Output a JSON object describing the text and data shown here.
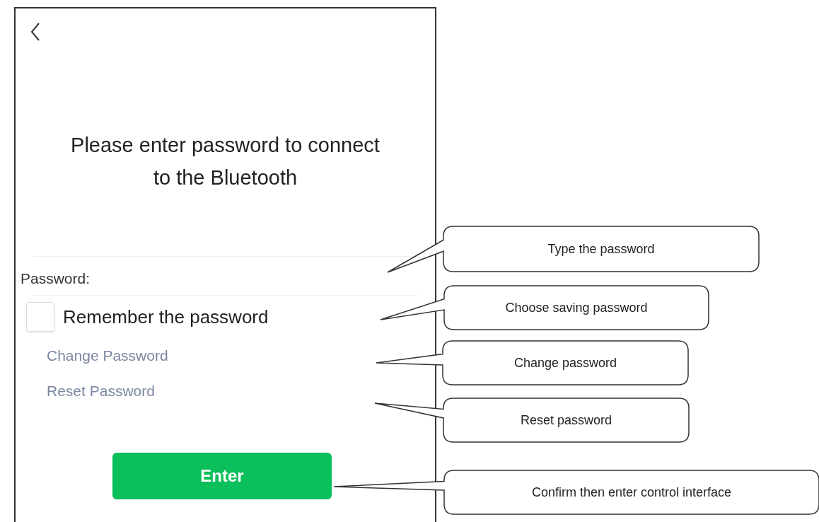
{
  "screen": {
    "title": "Please enter password to connect to the Bluetooth",
    "password": {
      "label": "Password:"
    },
    "remember": {
      "label": "Remember the password",
      "checked": false
    },
    "links": [
      "Change Password",
      "Reset Password"
    ],
    "enter_button": "Enter"
  },
  "callouts": [
    {
      "text": "Type the password"
    },
    {
      "text": "Choose saving password"
    },
    {
      "text": "Change password"
    },
    {
      "text": "Reset password"
    },
    {
      "text": "Confirm then enter control interface"
    }
  ]
}
